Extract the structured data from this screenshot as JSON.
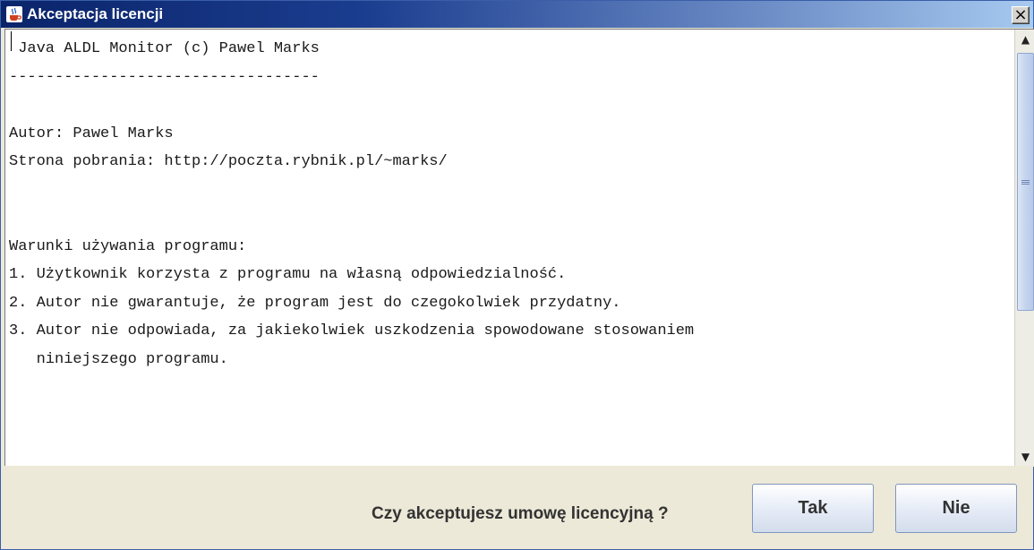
{
  "window": {
    "title": "Akceptacja licencji",
    "close_symbol": "×",
    "icon": "java-cup-icon"
  },
  "license": {
    "lines": [
      " Java ALDL Monitor (c) Pawel Marks",
      "----------------------------------",
      "",
      "Autor: Pawel Marks",
      "Strona pobrania: http://poczta.rybnik.pl/~marks/",
      "",
      "",
      "Warunki używania programu:",
      "1. Użytkownik korzysta z programu na własną odpowiedzialność.",
      "2. Autor nie gwarantuje, że program jest do czegokolwiek przydatny.",
      "3. Autor nie odpowiada, za jakiekolwiek uszkodzenia spowodowane stosowaniem",
      "   niniejszego programu."
    ]
  },
  "scrollbar": {
    "up_symbol": "▲",
    "down_symbol": "▼"
  },
  "footer": {
    "question": "Czy akceptujesz umowę licencyjną ?",
    "yes_label": "Tak",
    "no_label": "Nie"
  },
  "colors": {
    "titlebar_start": "#0a246a",
    "titlebar_end": "#a6caf0",
    "panel_bg": "#ece9d8"
  }
}
